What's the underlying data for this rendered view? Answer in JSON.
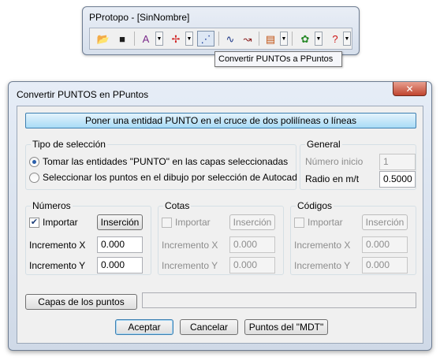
{
  "toolbar_window": {
    "title": "PProtopo - [SinNombre]",
    "tooltip": "Convertir PUNTOs a PPuntos",
    "buttons": [
      {
        "icon": "open-folder-icon",
        "glyph": "📂",
        "color": "#c89a2a"
      },
      {
        "icon": "save-disk-icon",
        "glyph": "■",
        "color": "#1e1e1e"
      },
      {
        "icon": "text-style-icon",
        "glyph": "A",
        "color": "#7a2a8a"
      },
      {
        "icon": "point-icon",
        "glyph": "✢",
        "color": "#d02020"
      },
      {
        "icon": "convert-points-icon",
        "glyph": "⋰",
        "color": "#1c3f9c"
      },
      {
        "icon": "polyline-icon",
        "glyph": "∿",
        "color": "#203a8a"
      },
      {
        "icon": "curve-points-icon",
        "glyph": "↝",
        "color": "#8a2020"
      },
      {
        "icon": "table-layers-icon",
        "glyph": "▤",
        "color": "#c05010"
      },
      {
        "icon": "gear-puzzle-icon",
        "glyph": "✿",
        "color": "#2a8a2a"
      },
      {
        "icon": "help-icon",
        "glyph": "?",
        "color": "#cc1111"
      }
    ],
    "dropdown_glyph": "▼"
  },
  "dialog": {
    "title": "Convertir PUNTOS en PPuntos",
    "close_glyph": "✕",
    "main_button": "Poner una entidad PUNTO en el cruce de dos polilíneas o líneas",
    "tipo_seleccion": {
      "legend": "Tipo de selección",
      "option1": "Tomar las entidades \"PUNTO\" en las capas seleccionadas",
      "option2": "Seleccionar los puntos en el dibujo por selección de Autocad",
      "selected": 1
    },
    "general": {
      "legend": "General",
      "numero_inicio_label": "Número inicio",
      "numero_inicio_value": "1",
      "radio_label": "Radio en m/t",
      "radio_value": "0.5000"
    },
    "numeros": {
      "legend": "Números",
      "importar_label": "Importar",
      "importar_checked": true,
      "insercion_label": "Inserción",
      "inc_x_label": "Incremento X",
      "inc_x_value": "0.000",
      "inc_y_label": "Incremento Y",
      "inc_y_value": "0.000"
    },
    "cotas": {
      "legend": "Cotas",
      "importar_label": "Importar",
      "importar_checked": false,
      "insercion_label": "Inserción",
      "inc_x_label": "Incremento X",
      "inc_x_value": "0.000",
      "inc_y_label": "Incremento Y",
      "inc_y_value": "0.000"
    },
    "codigos": {
      "legend": "Códigos",
      "importar_label": "Importar",
      "importar_checked": false,
      "insercion_label": "Inserción",
      "inc_x_label": "Incremento X",
      "inc_x_value": "0.000",
      "inc_y_label": "Incremento Y",
      "inc_y_value": "0.000"
    },
    "capas_button": "Capas de los puntos",
    "capas_value": "",
    "aceptar_button": "Aceptar",
    "cancelar_button": "Cancelar",
    "mdt_button": "Puntos del \"MDT\""
  }
}
